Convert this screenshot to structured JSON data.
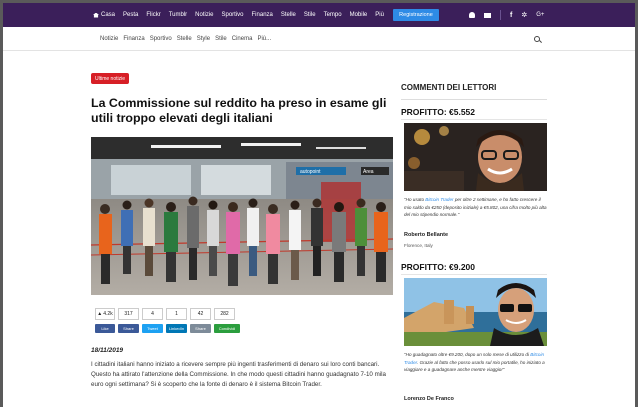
{
  "topbar": {
    "nav": [
      "Casa",
      "Pesta",
      "Flickr",
      "Tumblr",
      "Notizie",
      "Sportivo",
      "Finanza",
      "Stelle",
      "Stile",
      "Tempo",
      "Mobile",
      "Più"
    ],
    "register_label": "Registrazione",
    "social": [
      "f",
      "✲",
      "G+"
    ]
  },
  "subnav": {
    "items": [
      "Notizie",
      "Finanza",
      "Sportivo",
      "Stelle",
      "Style",
      "Stile",
      "Cinema",
      "Più..."
    ]
  },
  "article": {
    "badge": "Ultime notizie",
    "title": "La Commissione sul reddito ha preso in esame gli utili troppo elevati degli italiani",
    "photo_sign": "autopoint",
    "photo_sign2": "Area",
    "counts": [
      "4.2k",
      "317",
      "4",
      "1",
      "42",
      "282"
    ],
    "share": [
      "Like",
      "Share",
      "Tweet",
      "LinkedIn",
      "Share",
      "Condividi"
    ],
    "date": "18/11/2019",
    "body": "I cittadini italiani hanno iniziato a ricevere sempre più ingenti trasferimenti di denaro sui loro conti bancari. Questo ha attirato l'attenzione della Commissione. In che modo questi cittadini hanno guadagnato 7-10 mila euro ogni settimana? Si è scoperto che la fonte di denaro è il sistema Bitcoin Trader."
  },
  "sidebar": {
    "heading": "COMMENTI DEI LETTORI",
    "cards": [
      {
        "profit": "PROFITTO: €5.552",
        "quote_pre": "\"Ho usato ",
        "quote_link": "Bitcoin Trader",
        "quote_post": " per oltre 2 settimane, e ho fatto crescere il mio saldo da €250 (deposito iniziale) a €5.802, una cifra molto più alta del mio stipendio normale.\"",
        "name": "Roberto Bellante",
        "location": "Florence, Italy"
      },
      {
        "profit": "PROFITTO: €9.200",
        "quote_pre": "\"Ho guadagnato oltre €9.200, dopo un solo mese di utilizzo di ",
        "quote_link": "Bitcoin Trader",
        "quote_post": ". Grazie al fatto che posso usarlo sul mio portatile, ho iniziato a viaggiare e a guadagnare anche mentre viaggio!\"",
        "name": "Lorenzo De Franco",
        "location": ""
      }
    ]
  }
}
